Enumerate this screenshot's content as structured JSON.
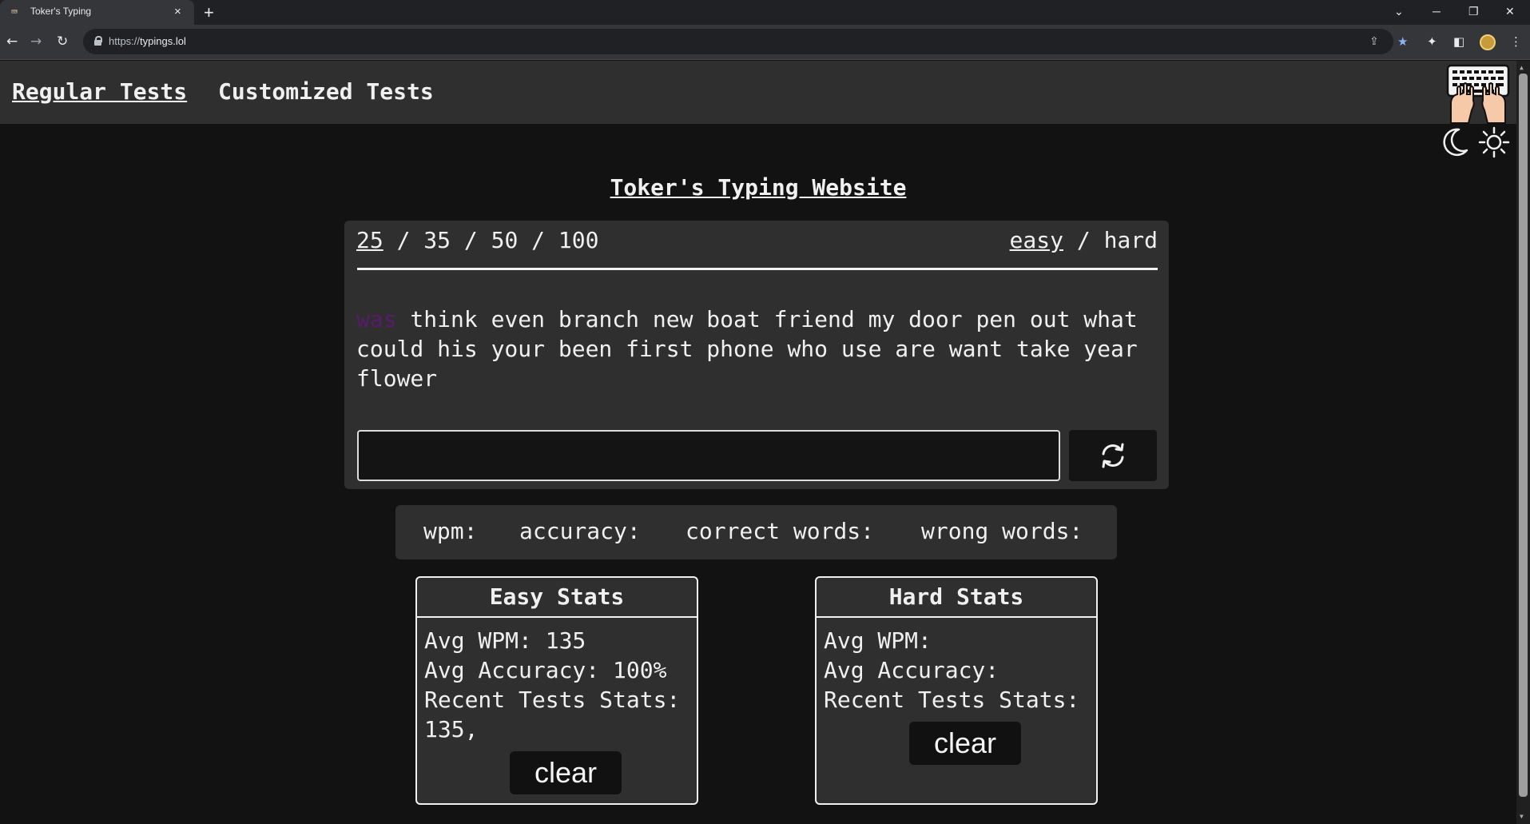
{
  "browser": {
    "tab_title": "Toker's Typing",
    "tab_close": "×",
    "new_tab": "+",
    "url_scheme": "https://",
    "url_host": "typings.lol"
  },
  "nav": {
    "regular_tests": "Regular Tests",
    "customized_tests": "Customized Tests"
  },
  "site_title": "Toker's Typing Website",
  "test": {
    "word_counts": [
      "25",
      "35",
      "50",
      "100"
    ],
    "selected_count": "25",
    "separator": " / ",
    "difficulties": [
      "easy",
      "hard"
    ],
    "selected_difficulty": "easy",
    "current_word": "was",
    "remaining_text": " think even branch new boat friend my door pen out what could his your been first phone who use are want take year flower",
    "input_value": ""
  },
  "results": {
    "wpm_label": "wpm:",
    "accuracy_label": "accuracy:",
    "correct_label": "correct words:",
    "wrong_label": "wrong words:"
  },
  "easy_stats": {
    "title": "Easy Stats",
    "avg_wpm": "Avg WPM: 135",
    "avg_accuracy": "Avg Accuracy: 100%",
    "recent_label": "Recent Tests Stats:",
    "recent_values": "135,",
    "clear_label": "clear"
  },
  "hard_stats": {
    "title": "Hard Stats",
    "avg_wpm": "Avg WPM:",
    "avg_accuracy": "Avg Accuracy:",
    "recent_label": "Recent Tests Stats:",
    "clear_label": "clear"
  },
  "colors": {
    "page_bg": "#121212",
    "panel_bg": "#2f2f2f",
    "text": "#f0f0f0",
    "current_word": "#5a1a6e"
  },
  "icons": [
    "keyboard-hands-logo-icon",
    "moon-icon",
    "sun-icon",
    "refresh-icon",
    "lock-icon",
    "star-icon",
    "puzzle-icon"
  ]
}
